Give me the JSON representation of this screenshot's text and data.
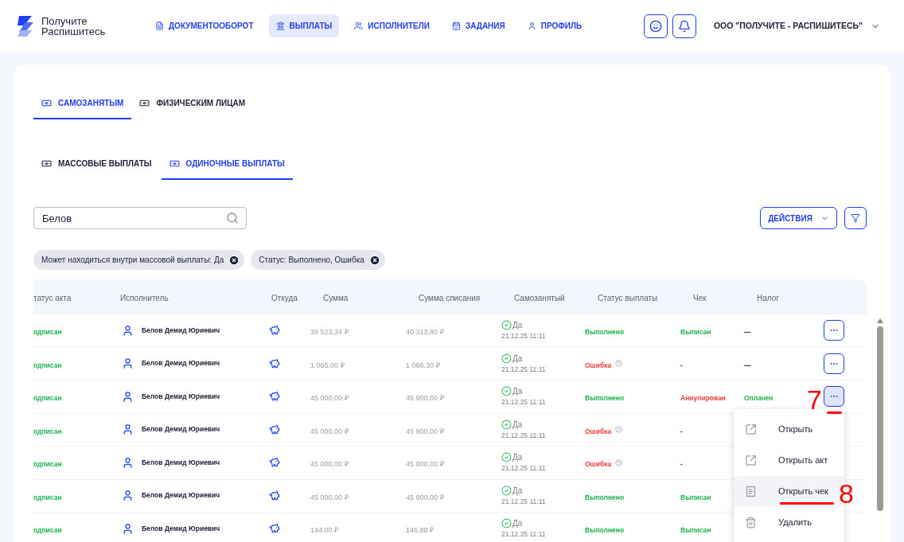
{
  "logo": {
    "lines": [
      "Получите",
      "Распишитесь"
    ]
  },
  "nav": [
    {
      "label": "ДОКУМЕНТООБОРОТ",
      "selected": false
    },
    {
      "label": "ВЫПЛАТЫ",
      "selected": true
    },
    {
      "label": "ИСПОЛНИТЕЛИ",
      "selected": false
    },
    {
      "label": "ЗАДАНИЯ",
      "selected": false
    },
    {
      "label": "ПРОФИЛЬ",
      "selected": false
    }
  ],
  "company": "ООО \"ПОЛУЧИТЕ - РАСПИШИТЕСЬ\"",
  "tabs": [
    {
      "label": "САМОЗАНЯТЫМ",
      "selected": true
    },
    {
      "label": "ФИЗИЧЕСКИМ ЛИЦАМ",
      "selected": false
    }
  ],
  "subtabs": [
    {
      "label": "МАССОВЫЕ ВЫПЛАТЫ",
      "selected": false
    },
    {
      "label": "ОДИНОЧНЫЕ ВЫПЛАТЫ",
      "selected": true
    }
  ],
  "search": {
    "value": "Белов"
  },
  "actions_button": "ДЕЙСТВИЯ",
  "filters": [
    "Может находиться внутри массовой выплаты: Да",
    "Статус: Выполнено, Ошибка"
  ],
  "table": {
    "columns": [
      "татус акта",
      "Исполнитель",
      "Откуда",
      "Сумма",
      "Сумма списания",
      "Самозанятый",
      "Статус выплаты",
      "Чек",
      "Налог"
    ],
    "rows": [
      {
        "act": "одписан",
        "performer": "Белов Демид Юриевич",
        "sum": "39 523,34 ₽",
        "debit": "40 313,80 ₽",
        "self_employed": "Да",
        "date": "21.12.25 11:11",
        "status": {
          "text": "Выполнено",
          "kind": "ok"
        },
        "receipt": {
          "text": "Выписан",
          "kind": "ok"
        },
        "tax": {
          "text": "—",
          "kind": "plain"
        },
        "menu_button": {
          "selected": false
        }
      },
      {
        "act": "одписан",
        "performer": "Белов Демид Юриевич",
        "sum": "1 065,00 ₽",
        "debit": "1 086,30 ₽",
        "self_employed": "Да",
        "date": "21.12.25 11:11",
        "status": {
          "text": "Ошибка",
          "kind": "error"
        },
        "receipt": {
          "text": "-",
          "kind": "plain"
        },
        "tax": {
          "text": "—",
          "kind": "plain"
        },
        "menu_button": {
          "selected": false
        }
      },
      {
        "act": "одписан",
        "performer": "Белов Демид Юриевич",
        "sum": "45 000,00 ₽",
        "debit": "45 900,00 ₽",
        "self_employed": "Да",
        "date": "21.12.25 11:11",
        "status": {
          "text": "Выполнено",
          "kind": "ok"
        },
        "receipt": {
          "text": "Аннулирован",
          "kind": "error"
        },
        "tax": {
          "text": "Оплачен",
          "kind": "ok"
        },
        "menu_button": {
          "selected": true
        }
      },
      {
        "act": "одписан",
        "performer": "Белов Демид Юриевич",
        "sum": "45 000,00 ₽",
        "debit": "45 900,00 ₽",
        "self_employed": "Да",
        "date": "21.12.25 11:11",
        "status": {
          "text": "Ошибка",
          "kind": "error"
        },
        "receipt": {
          "text": "-",
          "kind": "plain"
        }
      },
      {
        "act": "одписан",
        "performer": "Белов Демид Юриевич",
        "sum": "45 000,00 ₽",
        "debit": "45 900,00 ₽",
        "self_employed": "Да",
        "date": "21.12.25 11:11",
        "status": {
          "text": "Ошибка",
          "kind": "error"
        },
        "receipt": {
          "text": "-",
          "kind": "plain"
        }
      },
      {
        "act": "одписан",
        "performer": "Белов Демид Юриевич",
        "sum": "45 000,00 ₽",
        "debit": "45 900,00 ₽",
        "self_employed": "Да",
        "date": "21.12.25 11:11",
        "status": {
          "text": "Выполнено",
          "kind": "ok"
        },
        "receipt": {
          "text": "Выписан",
          "kind": "ok"
        }
      },
      {
        "act": "одписан",
        "performer": "Белов Демид Юриевич",
        "sum": "144,00 ₽",
        "debit": "146,88 ₽",
        "self_employed": "Да",
        "date": "21.12.25 11:11",
        "status": {
          "text": "Выполнено",
          "kind": "ok"
        },
        "receipt": {
          "text": "Выписан",
          "kind": "ok"
        }
      }
    ]
  },
  "row_menu": [
    {
      "label": "Открыть",
      "selected": false
    },
    {
      "label": "Открыть акт",
      "selected": false
    },
    {
      "label": "Открыть чек",
      "selected": true
    },
    {
      "label": "Удалить",
      "selected": false
    }
  ],
  "annotations": [
    {
      "label": "7"
    },
    {
      "label": "8"
    }
  ]
}
